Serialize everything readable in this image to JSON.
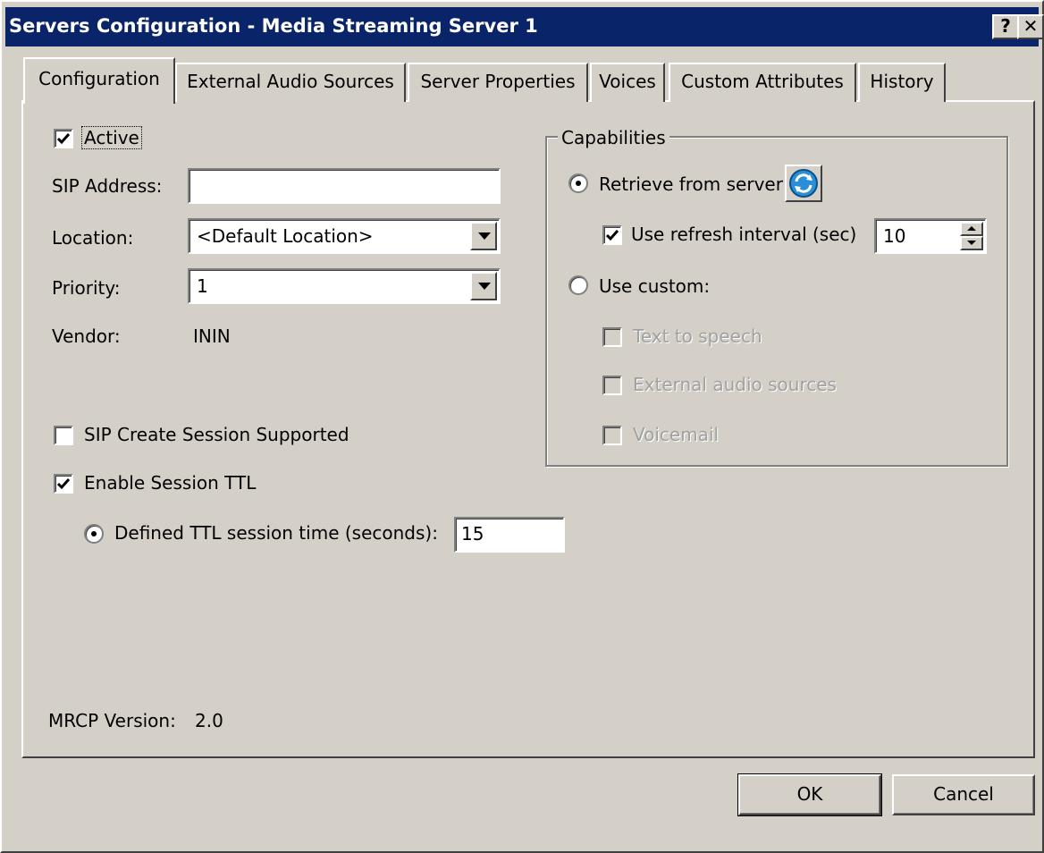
{
  "window": {
    "title": "Servers Configuration - Media Streaming Server 1",
    "help_label": "?",
    "close_label": "✕"
  },
  "tabs": [
    {
      "label": "Configuration",
      "active": true
    },
    {
      "label": "External Audio Sources",
      "active": false
    },
    {
      "label": "Server Properties",
      "active": false
    },
    {
      "label": "Voices",
      "active": false
    },
    {
      "label": "Custom Attributes",
      "active": false
    },
    {
      "label": "History",
      "active": false
    }
  ],
  "config": {
    "active": {
      "label": "Active",
      "checked": true
    },
    "sip_address": {
      "label": "SIP Address:",
      "value": ""
    },
    "location": {
      "label": "Location:",
      "value": "<Default Location>"
    },
    "priority": {
      "label": "Priority:",
      "value": "1"
    },
    "vendor": {
      "label": "Vendor:",
      "value": "ININ"
    },
    "sip_create_session": {
      "label": "SIP Create Session Supported",
      "checked": false
    },
    "enable_session_ttl": {
      "label": "Enable Session TTL",
      "checked": true
    },
    "defined_ttl": {
      "label": "Defined TTL session time (seconds):",
      "value": "15",
      "selected": true
    },
    "mrcp_version": {
      "label": "MRCP Version:",
      "value": "2.0"
    }
  },
  "capabilities": {
    "legend": "Capabilities",
    "retrieve_from_server": {
      "label": "Retrieve from server",
      "selected": true
    },
    "use_refresh_interval": {
      "label": "Use refresh interval (sec)",
      "checked": true,
      "value": "10"
    },
    "use_custom": {
      "label": "Use custom:",
      "selected": false
    },
    "text_to_speech": {
      "label": "Text to speech",
      "checked": false,
      "enabled": false
    },
    "external_audio_sources": {
      "label": "External audio sources",
      "checked": false,
      "enabled": false
    },
    "voicemail": {
      "label": "Voicemail",
      "checked": false,
      "enabled": false
    }
  },
  "buttons": {
    "ok": "OK",
    "cancel": "Cancel"
  },
  "colors": {
    "titlebar": "#0a246a",
    "face": "#d4d0c8"
  }
}
